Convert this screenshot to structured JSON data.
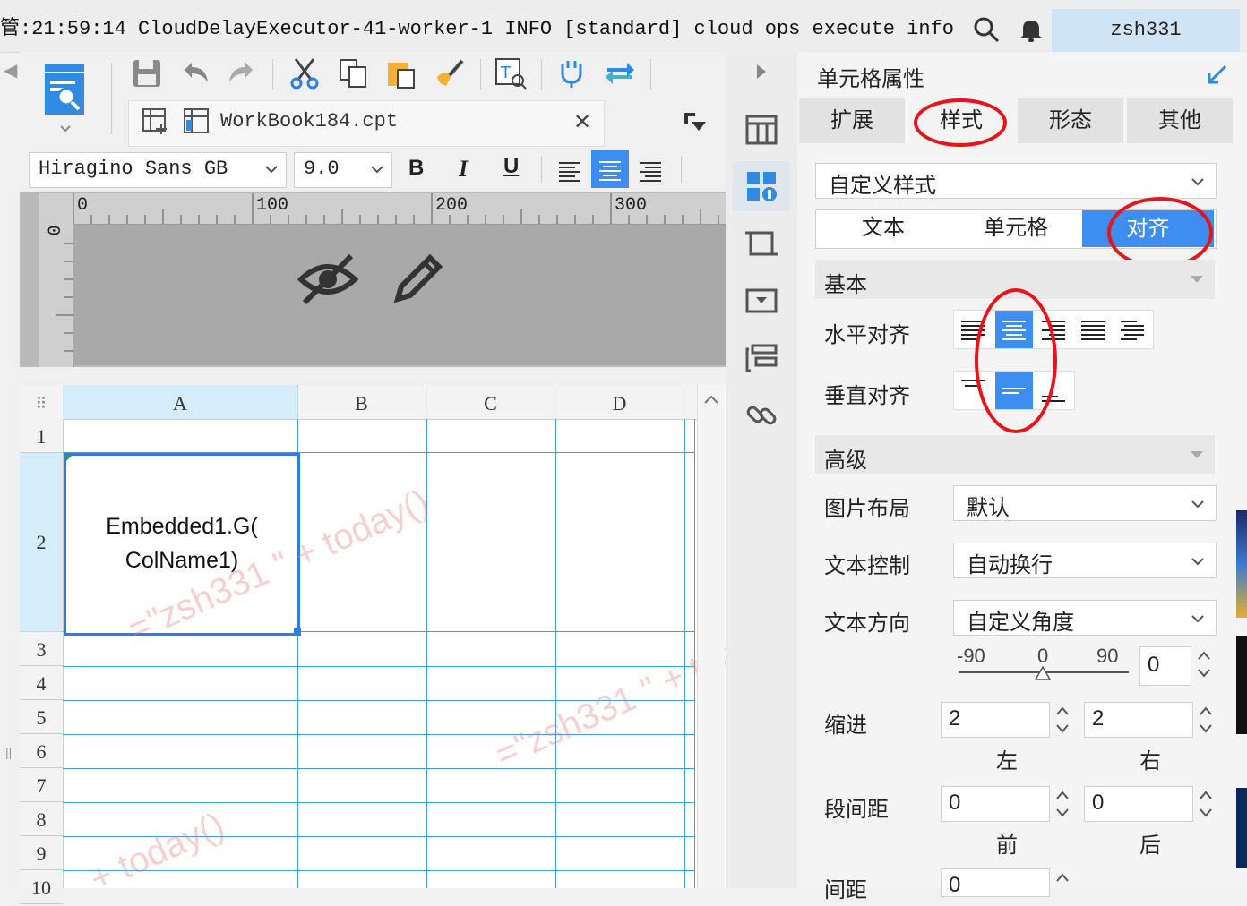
{
  "topbar": {
    "log_line": "管:21:59:14 CloudDelayExecutor-41-worker-1 INFO [standard] cloud ops execute info send t...",
    "user": "zsh331"
  },
  "toolbar": {
    "file_name": "WorkBook184.cpt",
    "font_name": "Hiragino Sans GB",
    "font_size": "9.0",
    "bold": "B",
    "italic": "I",
    "underline": "U"
  },
  "ruler": {
    "h_labels": [
      "0",
      "100",
      "200",
      "300"
    ],
    "v_label": "0"
  },
  "grid": {
    "columns": [
      "A",
      "B",
      "C",
      "D"
    ],
    "rows": [
      "1",
      "2",
      "3",
      "4",
      "5",
      "6",
      "7",
      "8",
      "9",
      "10"
    ],
    "selected_cell_line1": "Embedded1.G(",
    "selected_cell_line2": "ColName1)",
    "watermarks": [
      "=\"zsh331 \" + today()",
      "=\"zsh331 \" + today()",
      "+ today()"
    ]
  },
  "panel": {
    "title": "单元格属性",
    "tabs": [
      "扩展",
      "样式",
      "形态",
      "其他"
    ],
    "style_select": "自定义样式",
    "sub_tabs": [
      "文本",
      "单元格",
      "对齐"
    ],
    "basic_section": "基本",
    "h_align_label": "水平对齐",
    "v_align_label": "垂直对齐",
    "advanced_section": "高级",
    "image_layout_label": "图片布局",
    "image_layout_value": "默认",
    "text_control_label": "文本控制",
    "text_control_value": "自动换行",
    "text_direction_label": "文本方向",
    "text_direction_value": "自定义角度",
    "angle_ticks": [
      "-90",
      "0",
      "90"
    ],
    "angle_value": "0",
    "indent_label": "缩进",
    "indent_left": "2",
    "indent_right": "2",
    "indent_left_caption": "左",
    "indent_right_caption": "右",
    "para_spacing_label": "段间距",
    "para_before": "0",
    "para_after": "0",
    "para_before_caption": "前",
    "para_after_caption": "后",
    "spacing_label": "间距",
    "spacing_value": "0"
  },
  "colors": {
    "accent": "#3d8ef0",
    "grid_line": "#3aa0e0",
    "annotation_red": "#e8141a",
    "user_box": "#cfe4f5"
  }
}
